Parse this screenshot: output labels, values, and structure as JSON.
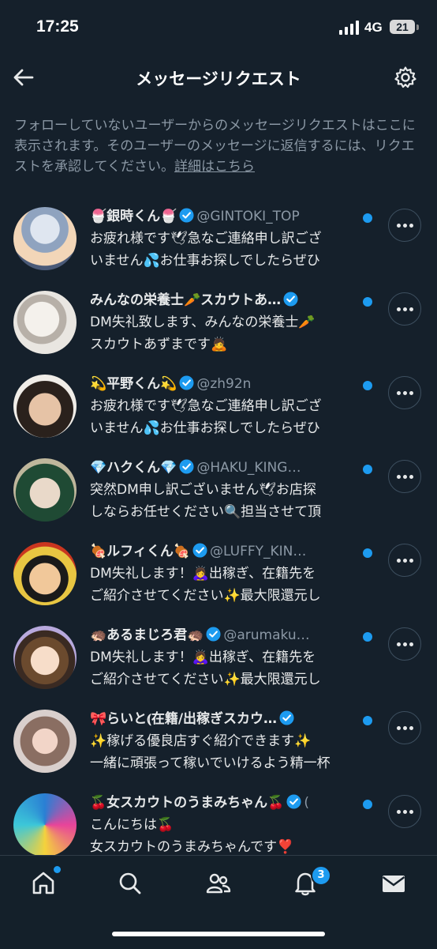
{
  "status_bar": {
    "time": "17:25",
    "network": "4G",
    "battery": "21"
  },
  "header": {
    "title": "メッセージリクエスト"
  },
  "notice": {
    "text": "フォローしていないユーザーからのメッセージリクエストはここに表示されます。そのユーザーのメッセージに返信するには、リクエストを承認してください。",
    "link": "詳細はこちら"
  },
  "requests": [
    {
      "name": "🍧銀時くん🍧",
      "handle": "@GINTOKI_TOP",
      "line1": "お疲れ様です🕊急なご連絡申し訳ござ",
      "line2": "いません💦お仕事お探しでしたらぜひ",
      "unread": true
    },
    {
      "name": "みんなの栄養士🥕スカウトあ…",
      "handle": "",
      "line1": "DM失礼致します、みんなの栄養士🥕",
      "line2": "スカウトあずまです🙇",
      "unread": true
    },
    {
      "name": "💫平野くん💫",
      "handle": "@zh92n",
      "line1": "お疲れ様です🕊急なご連絡申し訳ござ",
      "line2": "いません💦お仕事お探しでしたらぜひ",
      "unread": true
    },
    {
      "name": "💎ハクくん💎",
      "handle": "@HAKU_KING…",
      "line1": "突然DM申し訳ございません🕊お店探",
      "line2": "しならお任せください🔍担当させて頂",
      "unread": true
    },
    {
      "name": "🍖ルフィくん🍖",
      "handle": "@LUFFY_KIN…",
      "line1": "DM失礼します！🙇‍♀️出稼ぎ、在籍先を",
      "line2": "ご紹介させてください✨最大限還元し",
      "unread": true
    },
    {
      "name": "🦔あるまじろ君🦔",
      "handle": "@arumaku…",
      "line1": "DM失礼します！🙇‍♀️出稼ぎ、在籍先を",
      "line2": "ご紹介させてください✨最大限還元し",
      "unread": true
    },
    {
      "name": "🎀らいと⦅在籍/出稼ぎスカウ…",
      "handle": "",
      "line1": "✨稼げる優良店すぐ紹介できます✨",
      "line2": "一緒に頑張って稼いでいけるよう精一杯",
      "unread": true
    },
    {
      "name": "🍒女スカウトのうまみちゃん🍒",
      "handle": "(",
      "line1": "こんにちは🍒",
      "line2": "女スカウトのうまみちゃんです❣️",
      "unread": true
    }
  ],
  "nav": {
    "notifications_count": "3"
  },
  "colors": {
    "background": "#15202b",
    "accent": "#1d9bf0",
    "secondary_text": "#8b98a5"
  }
}
